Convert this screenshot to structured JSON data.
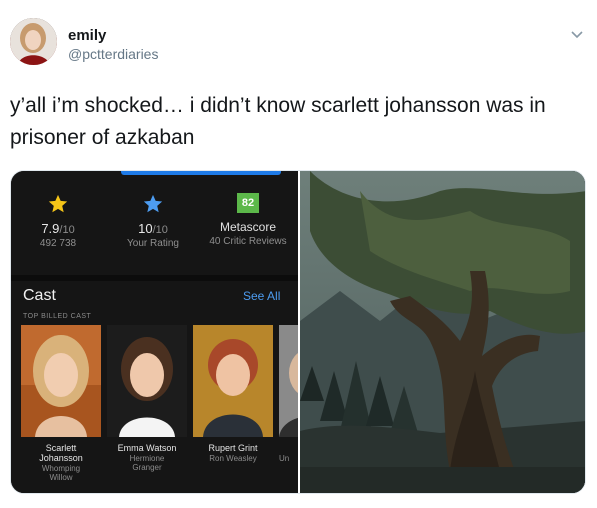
{
  "tweet": {
    "display_name": "emily",
    "handle": "@pctterdiaries",
    "text": "y’all i’m shocked… i didn’t know scarlett johansson was in prisoner of azkaban",
    "menu_icon": "chevron-down-icon"
  },
  "imdb": {
    "ratings": [
      {
        "value": "7.9",
        "out_of": "/10",
        "sub": "492 738",
        "icon": "star-gold-icon"
      },
      {
        "value": "10",
        "out_of": "/10",
        "sub": "Your Rating",
        "icon": "star-blue-icon"
      }
    ],
    "metascore": {
      "score": "82",
      "label": "Metascore",
      "sub": "40 Critic Reviews"
    },
    "cast_title": "Cast",
    "see_all": "See All",
    "cast_subtitle": "TOP BILLED CAST",
    "cast": [
      {
        "name_line1": "Scarlett",
        "name_line2": "Johansson",
        "role_line1": "Whomping",
        "role_line2": "Willow"
      },
      {
        "name_line1": "Emma Watson",
        "name_line2": "",
        "role_line1": "Hermione",
        "role_line2": "Granger"
      },
      {
        "name_line1": "Rupert Grint",
        "name_line2": "",
        "role_line1": "Ron Weasley",
        "role_line2": ""
      },
      {
        "name_line1": "",
        "name_line2": "",
        "role_line1": "Un",
        "role_line2": ""
      }
    ]
  },
  "colors": {
    "accent_blue": "#1e7be8",
    "link_blue": "#4d9cf0",
    "metascore_green": "#5cb84a",
    "star_gold": "#f5c518"
  }
}
